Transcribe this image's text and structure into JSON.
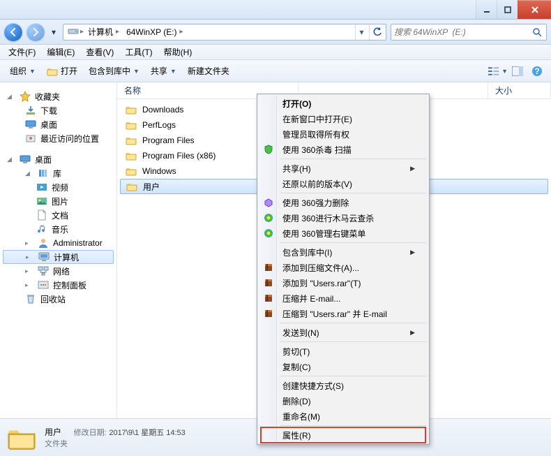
{
  "titlebar": {},
  "nav": {
    "breadcrumb": [
      "计算机",
      "64WinXP  (E:)"
    ],
    "history_arrow": "▾"
  },
  "search": {
    "placeholder": "搜索 64WinXP  (E:)"
  },
  "menubar": {
    "items": [
      "文件(F)",
      "编辑(E)",
      "查看(V)",
      "工具(T)",
      "帮助(H)"
    ]
  },
  "toolbar": {
    "organize": "组织",
    "open": "打开",
    "include": "包含到库中",
    "share": "共享",
    "newfolder": "新建文件夹"
  },
  "columns": {
    "name": "名称",
    "size": "大小"
  },
  "navpane": {
    "favorites": {
      "label": "收藏夹",
      "items": [
        "下载",
        "桌面",
        "最近访问的位置"
      ]
    },
    "desktop": {
      "label": "桌面",
      "lib": {
        "label": "库",
        "items": [
          "视频",
          "图片",
          "文档",
          "音乐"
        ]
      },
      "admin": "Administrator",
      "computer": "计算机",
      "network": "网络",
      "controlpanel": "控制面板",
      "recycle": "回收站"
    }
  },
  "files": {
    "items": [
      {
        "name": "Downloads"
      },
      {
        "name": "PerfLogs"
      },
      {
        "name": "Program Files"
      },
      {
        "name": "Program Files (x86)"
      },
      {
        "name": "Windows"
      },
      {
        "name": "用户",
        "selected": true
      }
    ]
  },
  "context_menu": {
    "open": "打开(O)",
    "open_new": "在新窗口中打开(E)",
    "admin_own": "管理员取得所有权",
    "scan360": "使用 360杀毒 扫描",
    "share": "共享(H)",
    "restore": "还原以前的版本(V)",
    "force_del": "使用 360强力删除",
    "trojan": "使用 360进行木马云查杀",
    "rightmenu": "使用 360管理右键菜单",
    "include_lib": "包含到库中(I)",
    "add_archive": "添加到压缩文件(A)...",
    "add_users_rar": "添加到 \"Users.rar\"(T)",
    "zip_email": "压缩并 E-mail...",
    "zip_users_email": "压缩到 \"Users.rar\" 并 E-mail",
    "send_to": "发送到(N)",
    "cut": "剪切(T)",
    "copy": "复制(C)",
    "shortcut": "创建快捷方式(S)",
    "delete": "删除(D)",
    "rename": "重命名(M)",
    "properties": "属性(R)"
  },
  "details": {
    "title": "用户",
    "date_label": "修改日期:",
    "date_val": "2017\\9\\1 星期五 14:53",
    "type": "文件夹"
  },
  "icons": {
    "folder": "folder",
    "computer": "computer"
  }
}
